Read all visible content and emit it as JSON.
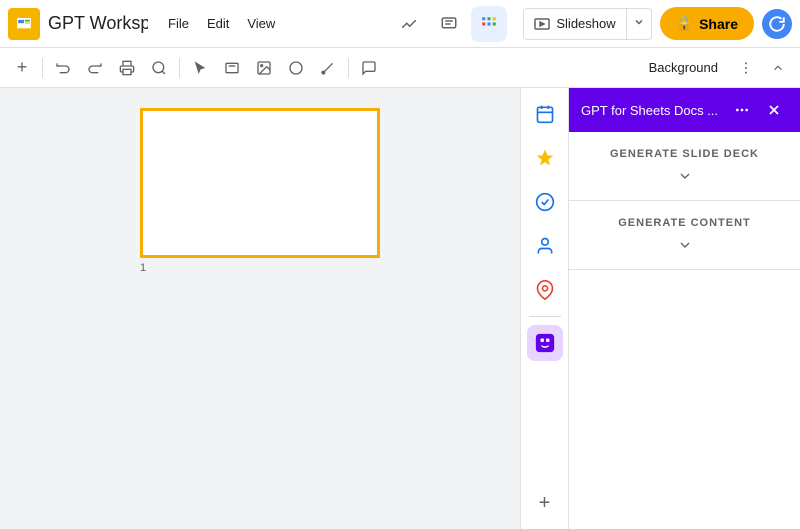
{
  "topbar": {
    "app_title": "GPT Workspac",
    "menu": [
      "File",
      "Edit",
      "View"
    ],
    "slideshow_label": "Slideshow",
    "share_label": "Share",
    "share_icon": "🔒"
  },
  "second_toolbar": {
    "background_label": "Background"
  },
  "slide": {
    "number": "1"
  },
  "right_panel": {
    "title": "GPT for Sheets Docs ...",
    "section1_title": "GENERATE SLIDE DECK",
    "section2_title": "GENERATE CONTENT"
  },
  "side_icons": {
    "calendar_icon": "📅",
    "star_icon": "⭐",
    "check_icon": "✅",
    "person_icon": "👤",
    "map_icon": "📍",
    "ai_icon": "🤖",
    "plus_icon": "+"
  }
}
